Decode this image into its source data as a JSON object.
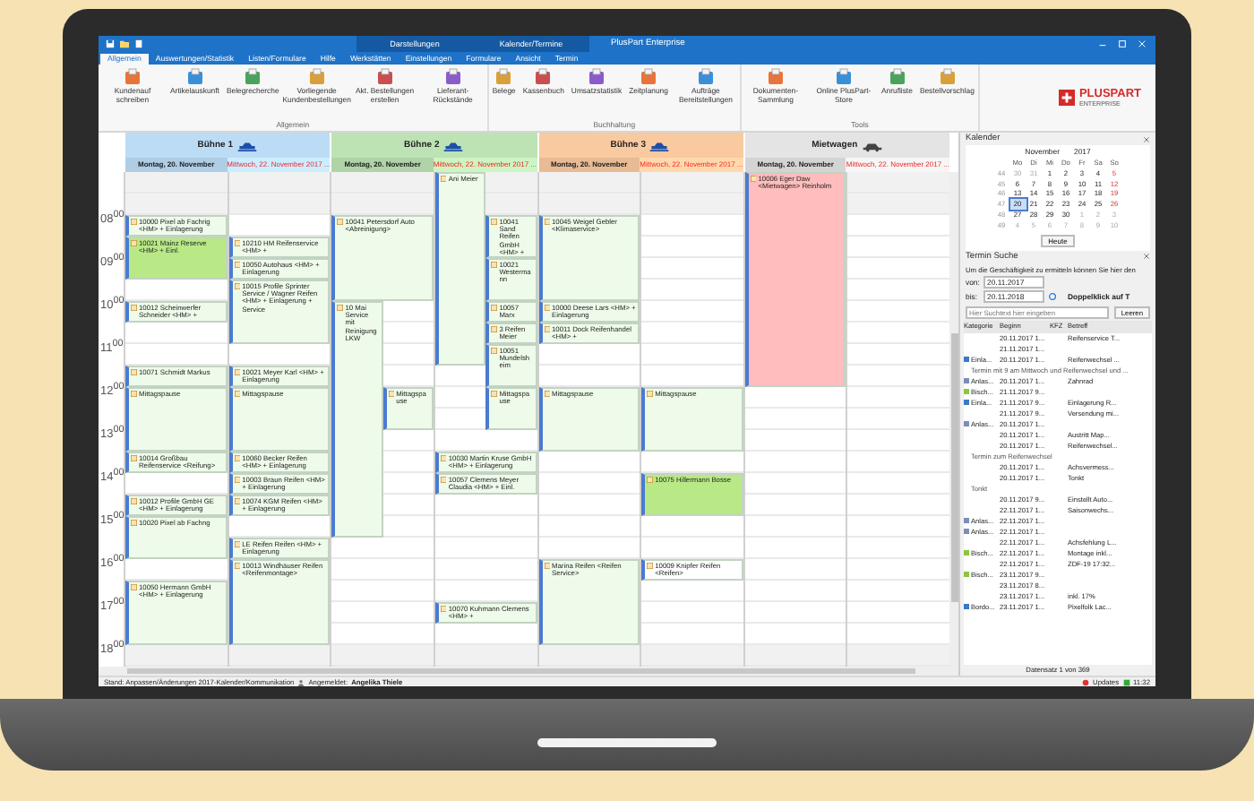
{
  "window": {
    "title": "PlusPart Enterprise",
    "context_groups": [
      "Darstellungen",
      "Kalender/Termine"
    ]
  },
  "ribbon": {
    "tabs": [
      {
        "label": "Allgemein",
        "selected": true
      },
      {
        "label": "Auswertungen/Statistik",
        "selected": false
      },
      {
        "label": "Listen/Formulare",
        "selected": false
      },
      {
        "label": "Hilfe",
        "selected": false
      },
      {
        "label": "Werkstätten",
        "selected": false
      },
      {
        "label": "Einstellungen",
        "selected": false
      },
      {
        "label": "Formulare",
        "selected": false
      },
      {
        "label": "Ansicht",
        "selected": false
      },
      {
        "label": "Termin",
        "selected": false
      }
    ],
    "groups": [
      {
        "label": "Allgemein",
        "buttons": [
          "Kundenauf schreiben",
          "Artikelauskunft",
          "Belegrecherche",
          "Vorliegende Kundenbestellungen",
          "Akt. Bestellungen erstellen",
          "Lieferant-Rückstände"
        ]
      },
      {
        "label": "Buchhaltung",
        "buttons": [
          "Belege",
          "Kassenbuch",
          "Umsatzstatistik",
          "Zeitplanung",
          "Aufträge Bereitstellungen"
        ]
      },
      {
        "label": "Tools",
        "buttons": [
          "Dokumenten-Sammlung",
          "Online PlusPart-Store",
          "Anrufliste",
          "Bestellvorschlag"
        ]
      }
    ],
    "logo": {
      "name": "PLUSPART",
      "tagline": "ENTERPRISE"
    }
  },
  "calendar": {
    "hours": [
      "08$^{00}$",
      "09$^{00}$",
      "10$^{00}$",
      "11$^{00}$",
      "12$^{00}$",
      "13$^{00}$",
      "14$^{00}$",
      "15$^{00}$",
      "16$^{00}$",
      "17$^{00}$",
      "18$^{00}$"
    ],
    "resources": [
      {
        "name": "Bühne 1",
        "kind": "lift",
        "color": "#bcdcf5",
        "days": [
          {
            "label": "Montag, 20. November",
            "highlight": false,
            "events": [
              {
                "text": "10000 Pixel ab Fachrig <HM> + Einlagerung",
                "color": "#eefbea"
              },
              {
                "text": "10021 Mainz Reserve <HM> + Einl.",
                "color": "#b8e986"
              },
              {
                "text": "10012 Scheinwerfer Schneider <HM> +",
                "color": "#eefbea"
              },
              {
                "text": "10071 Schmidt Markus",
                "color": "#eefbea"
              },
              {
                "text": "Mittagspause",
                "color": "#eefbea"
              },
              {
                "text": "10014 Großbau Reifenservice <Reifung>",
                "color": "#eefbea"
              },
              {
                "text": "10012 Profile GmbH GE <HM> + Einlagerung",
                "color": "#eefbea"
              },
              {
                "text": "10020 Pixel ab Fachng",
                "color": "#eefbea"
              },
              {
                "text": "10050 Hermann GmbH <HM> + Einlagerung",
                "color": "#eefbea"
              }
            ]
          },
          {
            "label": "Mittwoch, 22. November 2017 ...",
            "highlight": true,
            "events": [
              {
                "text": "10210 HM Reifenservice <HM> +",
                "color": "#eefbea"
              },
              {
                "text": "10050 Autohaus <HM> + Einlagerung",
                "color": "#eefbea"
              },
              {
                "text": "10015 Profile Sprinter Service / Wagner Reifen <HM> + Einlagerung + Service",
                "color": "#eefbea"
              },
              {
                "text": "10021 Meyer Karl <HM> + Einlagerung",
                "color": "#eefbea"
              },
              {
                "text": "Mittagspause",
                "color": "#eefbea"
              },
              {
                "text": "10060 Becker Reifen <HM> + Einlagerung",
                "color": "#eefbea"
              },
              {
                "text": "10003 Braun Reifen <HM> + Einlagerung",
                "color": "#eefbea"
              },
              {
                "text": "10074 KGM Reifen <HM> + Einlagerung",
                "color": "#eefbea"
              },
              {
                "text": "LE Reifen Reifen <HM> + Einlagerung",
                "color": "#eefbea"
              },
              {
                "text": "10013 Windhäuser Reifen <Reifenmontage>",
                "color": "#eefbea"
              }
            ]
          }
        ]
      },
      {
        "name": "Bühne 2",
        "kind": "lift",
        "color": "#bde3b5",
        "days": [
          {
            "label": "Montag, 20. November",
            "highlight": false,
            "events": [
              {
                "text": "10041 Petersdorf Auto <Abreinigung>",
                "color": "#eefbea"
              },
              {
                "text": "10 Mai Service mit Reinigung LKW",
                "color": "#eefbea"
              },
              {
                "text": "Mittagspause",
                "color": "#eefbea"
              }
            ]
          },
          {
            "label": "Mittwoch, 22. November 2017 ...",
            "highlight": true,
            "events": [
              {
                "text": "Ani Meier",
                "color": "#eefbea"
              },
              {
                "text": "10041 Sand Reifen GmbH <HM> +",
                "color": "#eefbea"
              },
              {
                "text": "10021 Westermann",
                "color": "#eefbea"
              },
              {
                "text": "10057 Marx",
                "color": "#eefbea"
              },
              {
                "text": "3 Reifen Meier",
                "color": "#eefbea"
              },
              {
                "text": "10051 Mundelsheim",
                "color": "#eefbea"
              },
              {
                "text": "Mittagspause",
                "color": "#eefbea"
              },
              {
                "text": "10030 Martin Kruse GmbH <HM> + Einlagerung",
                "color": "#eefbea"
              },
              {
                "text": "10057 Clemens Meyer Claudia <HM> + Einl.",
                "color": "#eefbea"
              },
              {
                "text": "10070 Kuhmann Clemens <HM> +",
                "color": "#eefbea"
              }
            ]
          }
        ]
      },
      {
        "name": "Bühne 3",
        "kind": "lift",
        "color": "#f9c9a0",
        "days": [
          {
            "label": "Montag, 20. November",
            "highlight": false,
            "events": [
              {
                "text": "10045 Weigel Gebler <Klimaservice>",
                "color": "#eefbea"
              },
              {
                "text": "10000 Deese Lars <HM> + Einlagerung",
                "color": "#eefbea"
              },
              {
                "text": "10011 Dock Reifenhandel <HM> +",
                "color": "#eefbea"
              },
              {
                "text": "Mittagspause",
                "color": "#eefbea"
              },
              {
                "text": "Marina Reifen <Reifen Service>",
                "color": "#eefbea"
              }
            ]
          },
          {
            "label": "Mittwoch, 22. November 2017 ...",
            "highlight": true,
            "events": [
              {
                "text": "Mittagspause",
                "color": "#eefbea"
              },
              {
                "text": "10075 Hillermann Bosse",
                "color": "#b8e986"
              },
              {
                "text": "10009 Knipfer Reifen <Reifen>",
                "color": "#ffffff"
              }
            ]
          }
        ]
      },
      {
        "name": "Mietwagen",
        "kind": "car",
        "color": "#e4e4e4",
        "days": [
          {
            "label": "Montag, 20. November",
            "highlight": false,
            "events": [
              {
                "text": "10006 Eger Daw <Mietwagen> Reinholm",
                "color": "#ffbdbd"
              }
            ]
          },
          {
            "label": "Mittwoch, 22. November 2017 ...",
            "highlight": true
          }
        ]
      }
    ]
  },
  "side_panel": {
    "calendar_title": "Kalender",
    "month": "November",
    "year": "2017",
    "weekdays": [
      "Mo",
      "Di",
      "Mi",
      "Do",
      "Fr",
      "Sa",
      "So"
    ],
    "weeks": [
      {
        "week": "44",
        "days": [
          {
            "d": "30",
            "other_month": true,
            "selected": false
          },
          {
            "d": "31",
            "other_month": true,
            "selected": false
          },
          {
            "d": "1",
            "other_month": false,
            "selected": false
          },
          {
            "d": "2",
            "other_month": false,
            "selected": false
          },
          {
            "d": "3",
            "other_month": false,
            "selected": false
          },
          {
            "d": "4",
            "other_month": false,
            "selected": false
          },
          {
            "d": "5",
            "other_month": false,
            "selected": false
          }
        ]
      },
      {
        "week": "45",
        "days": [
          {
            "d": "6",
            "other_month": false,
            "selected": false
          },
          {
            "d": "7",
            "other_month": false,
            "selected": false
          },
          {
            "d": "8",
            "other_month": false,
            "selected": false
          },
          {
            "d": "9",
            "other_month": false,
            "selected": false
          },
          {
            "d": "10",
            "other_month": false,
            "selected": false
          },
          {
            "d": "11",
            "other_month": false,
            "selected": false
          },
          {
            "d": "12",
            "other_month": false,
            "selected": false
          }
        ]
      },
      {
        "week": "46",
        "days": [
          {
            "d": "13",
            "other_month": false,
            "selected": false
          },
          {
            "d": "14",
            "other_month": false,
            "selected": false
          },
          {
            "d": "15",
            "other_month": false,
            "selected": false
          },
          {
            "d": "16",
            "other_month": false,
            "selected": false
          },
          {
            "d": "17",
            "other_month": false,
            "selected": false
          },
          {
            "d": "18",
            "other_month": false,
            "selected": false
          },
          {
            "d": "19",
            "other_month": false,
            "selected": false
          }
        ]
      },
      {
        "week": "47",
        "days": [
          {
            "d": "20",
            "other_month": false,
            "selected": true
          },
          {
            "d": "21",
            "other_month": false,
            "selected": false
          },
          {
            "d": "22",
            "other_month": false,
            "selected": false
          },
          {
            "d": "23",
            "other_month": false,
            "selected": false
          },
          {
            "d": "24",
            "other_month": false,
            "selected": false
          },
          {
            "d": "25",
            "other_month": false,
            "selected": false
          },
          {
            "d": "26",
            "other_month": false,
            "selected": false
          }
        ]
      },
      {
        "week": "48",
        "days": [
          {
            "d": "27",
            "other_month": false,
            "selected": false
          },
          {
            "d": "28",
            "other_month": false,
            "selected": false
          },
          {
            "d": "29",
            "other_month": false,
            "selected": false
          },
          {
            "d": "30",
            "other_month": false,
            "selected": false
          },
          {
            "d": "1",
            "other_month": true,
            "selected": false
          },
          {
            "d": "2",
            "other_month": true,
            "selected": false
          },
          {
            "d": "3",
            "other_month": true,
            "selected": false
          }
        ]
      },
      {
        "week": "49",
        "days": [
          {
            "d": "4",
            "other_month": true,
            "selected": false
          },
          {
            "d": "5",
            "other_month": true,
            "selected": false
          },
          {
            "d": "6",
            "other_month": true,
            "selected": false
          },
          {
            "d": "7",
            "other_month": true,
            "selected": false
          },
          {
            "d": "8",
            "other_month": true,
            "selected": false
          },
          {
            "d": "9",
            "other_month": true,
            "selected": false
          },
          {
            "d": "10",
            "other_month": true,
            "selected": false
          }
        ]
      }
    ],
    "today_button": "Heute",
    "search_title": "Termin Suche",
    "description": "Um die Geschäftigkeit zu ermitteln können Sie hier den",
    "from_label": "von:",
    "from_value": "20.11.2017",
    "to_label": "bis:",
    "to_value": "20.11.2018",
    "hint": "Doppelklick auf T",
    "search": {
      "placeholder": "Hier Suchtext hier eingeben"
    },
    "clear_button": "Leeren",
    "columns": [
      "Kategorie",
      "Beginn",
      "KFZ",
      "Betreff"
    ],
    "rows": [
      {
        "kind": "item",
        "begin": "20.11.2017 1...",
        "subject": "Reifenservice T..."
      },
      {
        "kind": "item",
        "begin": "21.11.2017 1..."
      },
      {
        "kind": "item",
        "category": "Einla...",
        "color": "#3a78c8",
        "begin": "20.11.2017 1...",
        "subject": "Reifenwechsel ..."
      },
      {
        "kind": "group",
        "text": "Termin mit 9 am Mittwoch und Reifenwechsel und ..."
      },
      {
        "kind": "item",
        "category": "Anlas...",
        "color": "#7a8fb8",
        "begin": "20.11.2017 1...",
        "subject": "Zahnrad"
      },
      {
        "kind": "item",
        "category": "Bisch...",
        "color": "#8cc63f",
        "begin": "21.11.2017 9..."
      },
      {
        "kind": "item",
        "category": "Einla...",
        "color": "#3a78c8",
        "begin": "21.11.2017 9...",
        "subject": "Einlagerung R..."
      },
      {
        "kind": "item",
        "begin": "21.11.2017 9...",
        "subject": "Versendung mi..."
      },
      {
        "kind": "item",
        "category": "Anlas...",
        "color": "#7a8fb8",
        "begin": "20.11.2017 1..."
      },
      {
        "kind": "item",
        "begin": "20.11.2017 1...",
        "subject": "Austritt Map..."
      },
      {
        "kind": "item",
        "begin": "20.11.2017 1...",
        "subject": "Reifenwechsel..."
      },
      {
        "kind": "group",
        "text": "Termin zum Reifenwechsel"
      },
      {
        "kind": "item",
        "begin": "20.11.2017 1...",
        "subject": "Achsvermess..."
      },
      {
        "kind": "item",
        "begin": "20.11.2017 1...",
        "subject": "Tonkt"
      },
      {
        "kind": "group",
        "text": "Tonkt"
      },
      {
        "kind": "item",
        "begin": "20.11.2017 9...",
        "subject": "Einstellt Auto..."
      },
      {
        "kind": "item",
        "begin": "22.11.2017 1...",
        "subject": "Saisonwechs..."
      },
      {
        "kind": "item",
        "category": "Anlas...",
        "color": "#7a8fb8",
        "begin": "22.11.2017 1..."
      },
      {
        "kind": "item",
        "category": "Anlas...",
        "color": "#7a8fb8",
        "begin": "22.11.2017 1..."
      },
      {
        "kind": "item",
        "begin": "22.11.2017 1...",
        "subject": "Achsfehlung L..."
      },
      {
        "kind": "item",
        "category": "Bisch...",
        "color": "#8cc63f",
        "begin": "22.11.2017 1...",
        "subject": "Montage inkl..."
      },
      {
        "kind": "item",
        "begin": "22.11.2017 1...",
        "subject": "ZDF-19 17:32..."
      },
      {
        "kind": "item",
        "category": "Bisch...",
        "color": "#8cc63f",
        "begin": "23.11.2017 9..."
      },
      {
        "kind": "item",
        "begin": "23.11.2017 8..."
      },
      {
        "kind": "item",
        "begin": "23.11.2017 1...",
        "subject": "inkl. 17%"
      },
      {
        "kind": "item",
        "category": "Bordo...",
        "color": "#3a78c8",
        "begin": "23.11.2017 1...",
        "subject": "Pixelfolk Lac..."
      }
    ],
    "record_count": "Datensatz 1 von 369"
  },
  "status_bar": {
    "left": "Stand: Anpassen/Änderungen 2017-Kalender/Kommunikation",
    "user_label": "Angemeldet:",
    "user": "Angelika Thiele",
    "updates": "Updates",
    "time": "11:32"
  }
}
